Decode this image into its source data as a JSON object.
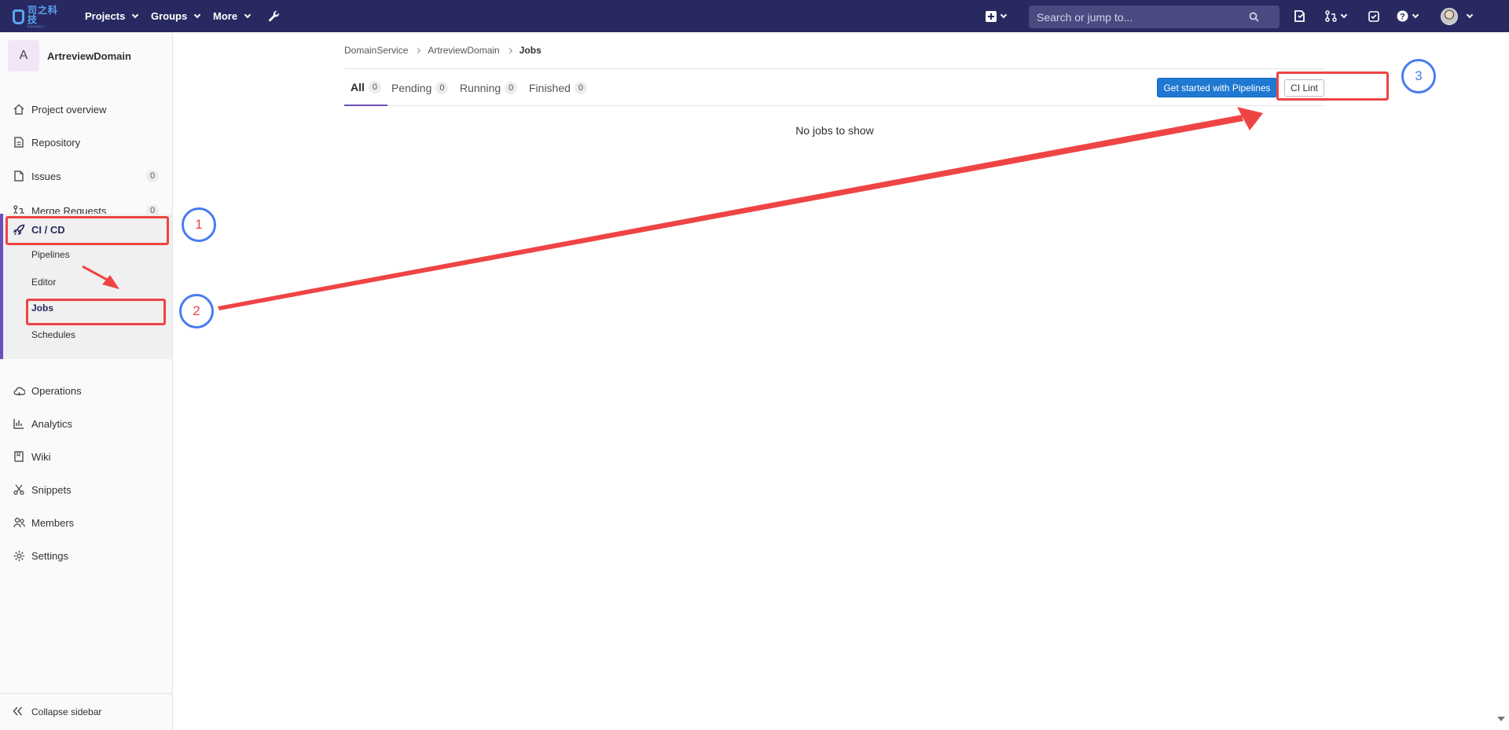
{
  "navbar": {
    "logo_text": "司之科技",
    "logo_subtext": "SIZHIKEJI",
    "menus": [
      "Projects",
      "Groups",
      "More"
    ],
    "search_placeholder": "Search or jump to..."
  },
  "sidebar": {
    "project_avatar": "A",
    "project_name": "ArtreviewDomain",
    "items": [
      {
        "label": "Project overview",
        "icon": "home-icon"
      },
      {
        "label": "Repository",
        "icon": "doc-icon"
      },
      {
        "label": "Issues",
        "icon": "issues-icon",
        "count": "0"
      },
      {
        "label": "Merge Requests",
        "icon": "merge-request-icon",
        "count": "0"
      },
      {
        "label": "CI / CD",
        "icon": "rocket-icon"
      },
      {
        "label": "Operations",
        "icon": "cloud-icon"
      },
      {
        "label": "Analytics",
        "icon": "chart-icon"
      },
      {
        "label": "Wiki",
        "icon": "book-icon"
      },
      {
        "label": "Snippets",
        "icon": "scissors-icon"
      },
      {
        "label": "Members",
        "icon": "users-icon"
      },
      {
        "label": "Settings",
        "icon": "gear-icon"
      }
    ],
    "cicd_subitems": [
      "Pipelines",
      "Editor",
      "Jobs",
      "Schedules"
    ],
    "collapse_label": "Collapse sidebar"
  },
  "breadcrumb": [
    "DomainService",
    "ArtreviewDomain",
    "Jobs"
  ],
  "tabs": [
    {
      "label": "All",
      "count": "0"
    },
    {
      "label": "Pending",
      "count": "0"
    },
    {
      "label": "Running",
      "count": "0"
    },
    {
      "label": "Finished",
      "count": "0"
    }
  ],
  "buttons": {
    "get_started": "Get started with Pipelines",
    "ci_lint": "CI Lint"
  },
  "empty_message": "No jobs to show",
  "annotations": {
    "circle_1": "1",
    "circle_2": "2",
    "circle_3": "3"
  },
  "colors": {
    "navbar": "#292961",
    "accent": "#6b4fbb",
    "primary_button": "#1f78d1",
    "annotation_red": "#ef4444",
    "annotation_blue": "#4a7cf0"
  }
}
